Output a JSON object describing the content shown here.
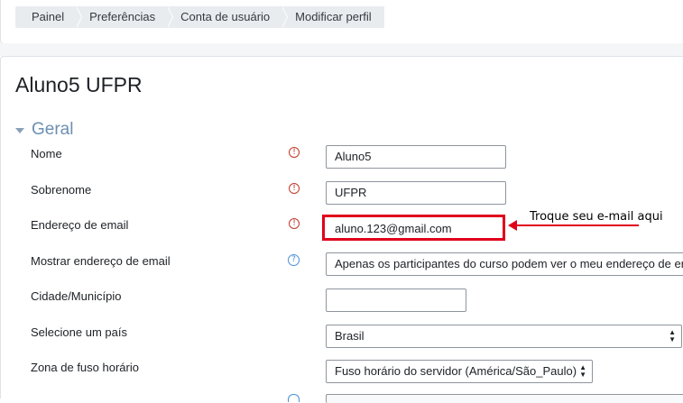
{
  "breadcrumb": [
    "Painel",
    "Preferências",
    "Conta de usuário",
    "Modificar perfil"
  ],
  "page_title": "Aluno5 UFPR",
  "section": {
    "title": "Geral"
  },
  "fields": {
    "nome": {
      "label": "Nome",
      "value": "Aluno5",
      "icon": "required-icon"
    },
    "sobrenome": {
      "label": "Sobrenome",
      "value": "UFPR",
      "icon": "required-icon"
    },
    "email": {
      "label": "Endereço de email",
      "value": "aluno.123@gmail.com",
      "icon": "required-icon"
    },
    "mostrar_email": {
      "label": "Mostrar endereço de email",
      "value": "Apenas os participantes do curso podem ver o meu endereço de email",
      "icon": "help-icon"
    },
    "cidade": {
      "label": "Cidade/Município",
      "value": ""
    },
    "pais": {
      "label": "Selecione um país",
      "value": "Brasil"
    },
    "fuso": {
      "label": "Zona de fuso horário",
      "value": "Fuso horário do servidor (América/São_Paulo)"
    }
  },
  "annotation": {
    "text": "Troque seu e-mail aqui",
    "color": "#e0001b"
  }
}
